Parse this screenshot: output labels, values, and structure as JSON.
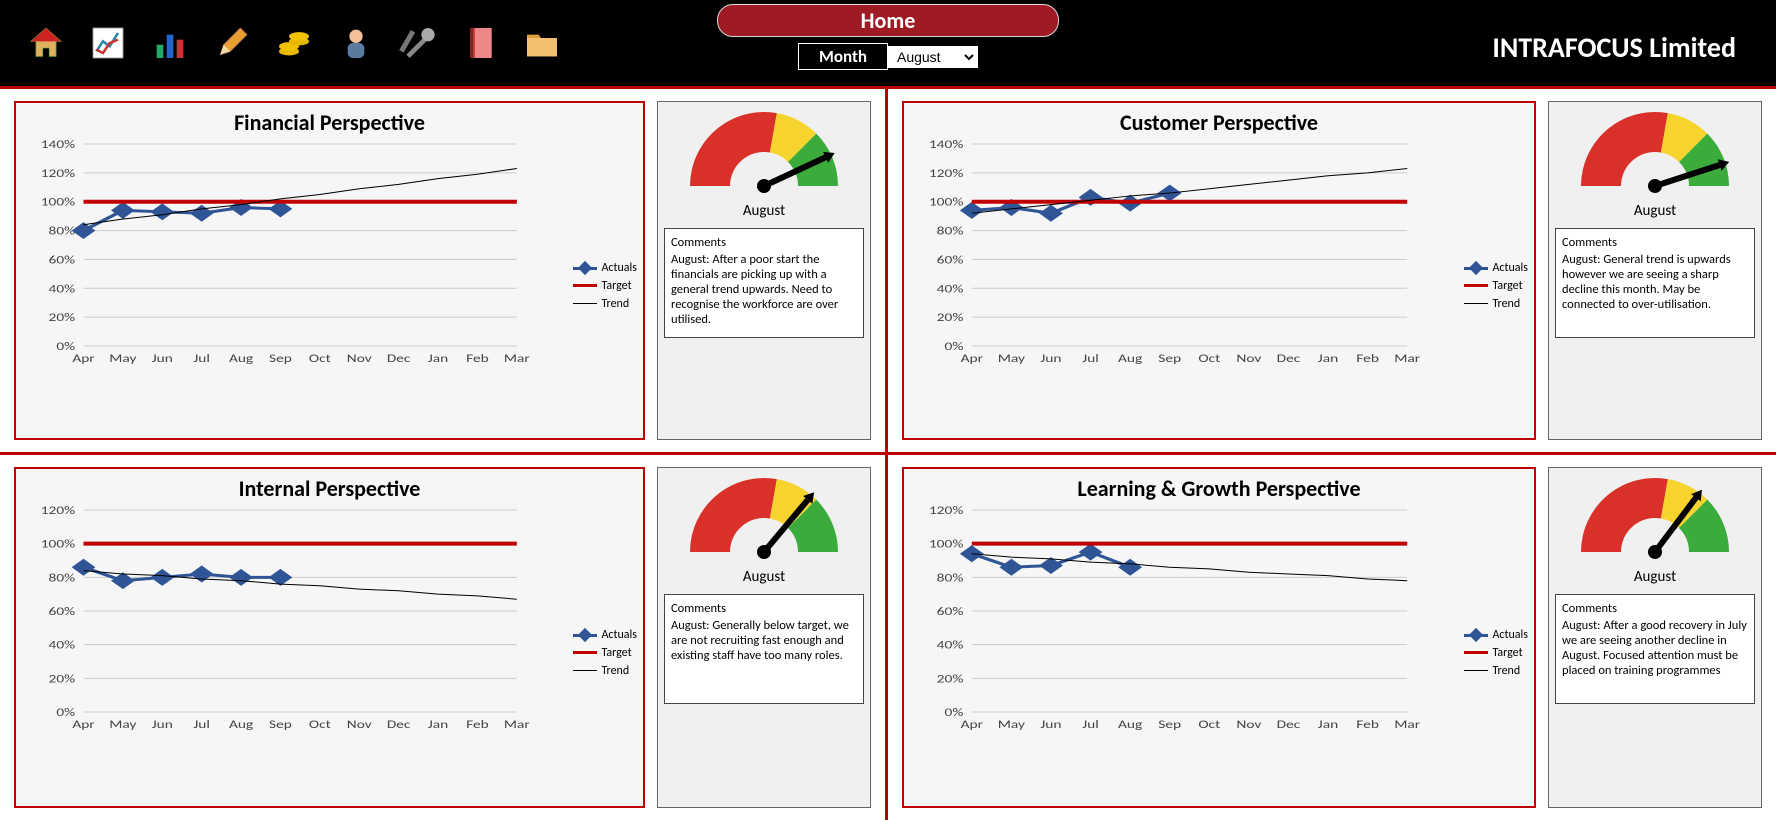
{
  "header": {
    "home_label": "Home",
    "month_label": "Month",
    "month_value": "August",
    "company": "INTRAFOCUS Limited",
    "icons": [
      "home",
      "chart-report",
      "bar-chart",
      "pencil",
      "coins",
      "user",
      "tools",
      "notebook",
      "folder"
    ]
  },
  "legend": {
    "actuals": "Actuals",
    "target": "Target",
    "trend": "Trend"
  },
  "comments_label": "Comments",
  "gauge_label": "August",
  "panels": [
    {
      "id": "financial",
      "title": "Financial Perspective",
      "comment": "August: After a poor start the financials are picking up with a general trend upwards.  Need to recognise the workforce are over utilised.",
      "gauge_angle": 155
    },
    {
      "id": "customer",
      "title": "Customer Perspective",
      "comment": "August: General trend is upwards however we are seeing a sharp decline this month.  May be connected to over-utilisation.",
      "gauge_angle": 162
    },
    {
      "id": "internal",
      "title": "Internal Perspective",
      "comment": "August: Generally below target, we are not recruiting fast enough and existing staff have too many roles.",
      "gauge_angle": 130
    },
    {
      "id": "learning",
      "title": "Learning & Growth Perspective",
      "comment": "August: After a good recovery in July we are seeing another decline in August.  Focused attention must be placed on training programmes",
      "gauge_angle": 127
    }
  ],
  "chart_data": [
    {
      "panel": "financial",
      "type": "line",
      "title": "Financial Perspective",
      "xlabel": "",
      "ylabel": "",
      "ylim": [
        0,
        140
      ],
      "categories": [
        "Apr",
        "May",
        "Jun",
        "Jul",
        "Aug",
        "Sep",
        "Oct",
        "Nov",
        "Dec",
        "Jan",
        "Feb",
        "Mar"
      ],
      "series": [
        {
          "name": "Actuals",
          "values": [
            80,
            94,
            93,
            92,
            96,
            95,
            null,
            null,
            null,
            null,
            null,
            null
          ]
        },
        {
          "name": "Target",
          "values": [
            100,
            100,
            100,
            100,
            100,
            100,
            100,
            100,
            100,
            100,
            100,
            100
          ]
        },
        {
          "name": "Trend",
          "values": [
            84,
            88,
            91,
            95,
            98,
            102,
            105,
            109,
            112,
            116,
            119,
            123
          ]
        }
      ]
    },
    {
      "panel": "customer",
      "type": "line",
      "title": "Customer Perspective",
      "xlabel": "",
      "ylabel": "",
      "ylim": [
        0,
        140
      ],
      "categories": [
        "Apr",
        "May",
        "Jun",
        "Jul",
        "Aug",
        "Sep",
        "Oct",
        "Nov",
        "Dec",
        "Jan",
        "Feb",
        "Mar"
      ],
      "series": [
        {
          "name": "Actuals",
          "values": [
            94,
            96,
            92,
            103,
            99,
            106,
            null,
            null,
            null,
            null,
            null,
            null
          ]
        },
        {
          "name": "Target",
          "values": [
            100,
            100,
            100,
            100,
            100,
            100,
            100,
            100,
            100,
            100,
            100,
            100
          ]
        },
        {
          "name": "Trend",
          "values": [
            92,
            95,
            98,
            101,
            104,
            106,
            109,
            112,
            115,
            118,
            120,
            123
          ]
        }
      ]
    },
    {
      "panel": "internal",
      "type": "line",
      "title": "Internal Perspective",
      "xlabel": "",
      "ylabel": "",
      "ylim": [
        0,
        120
      ],
      "categories": [
        "Apr",
        "May",
        "Jun",
        "Jul",
        "Aug",
        "Sep",
        "Oct",
        "Nov",
        "Dec",
        "Jan",
        "Feb",
        "Mar"
      ],
      "series": [
        {
          "name": "Actuals",
          "values": [
            86,
            78,
            80,
            82,
            80,
            80,
            null,
            null,
            null,
            null,
            null,
            null
          ]
        },
        {
          "name": "Target",
          "values": [
            100,
            100,
            100,
            100,
            100,
            100,
            100,
            100,
            100,
            100,
            100,
            100
          ]
        },
        {
          "name": "Trend",
          "values": [
            84,
            82,
            81,
            79,
            78,
            76,
            75,
            73,
            72,
            70,
            69,
            67
          ]
        }
      ]
    },
    {
      "panel": "learning",
      "type": "line",
      "title": "Learning & Growth Perspective",
      "xlabel": "",
      "ylabel": "",
      "ylim": [
        0,
        120
      ],
      "categories": [
        "Apr",
        "May",
        "Jun",
        "Jul",
        "Aug",
        "Sep",
        "Oct",
        "Nov",
        "Dec",
        "Jan",
        "Feb",
        "Mar"
      ],
      "series": [
        {
          "name": "Actuals",
          "values": [
            94,
            86,
            87,
            95,
            86,
            null,
            null,
            null,
            null,
            null,
            null,
            null
          ]
        },
        {
          "name": "Target",
          "values": [
            100,
            100,
            100,
            100,
            100,
            100,
            100,
            100,
            100,
            100,
            100,
            100
          ]
        },
        {
          "name": "Trend",
          "values": [
            94,
            92,
            91,
            89,
            88,
            86,
            85,
            83,
            82,
            81,
            79,
            78
          ]
        }
      ]
    }
  ]
}
